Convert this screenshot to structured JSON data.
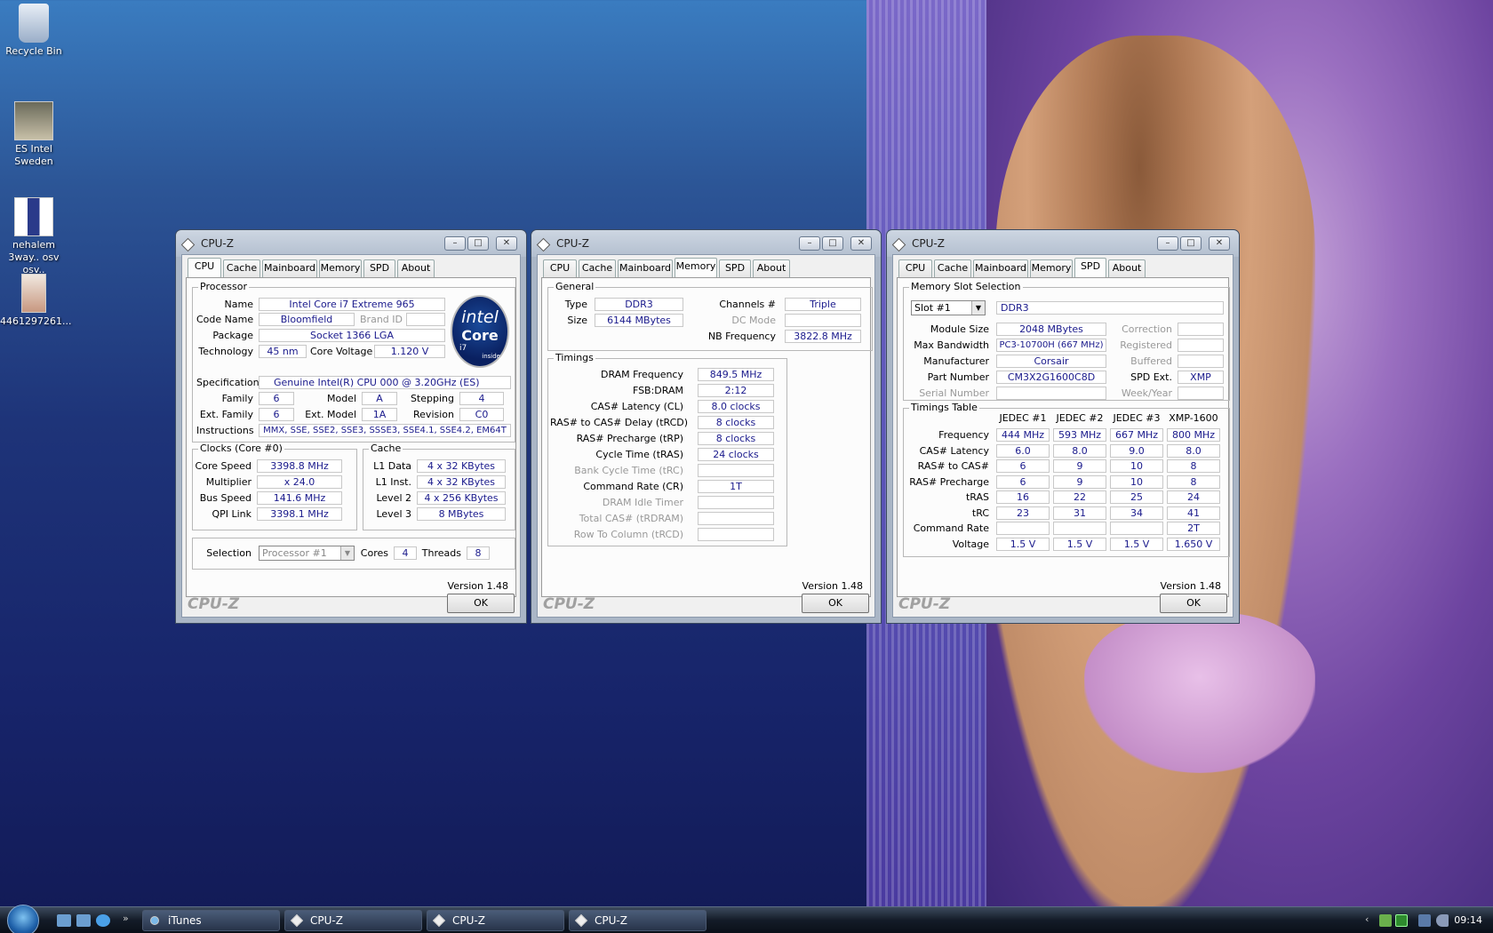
{
  "desktop": {
    "icons": [
      {
        "label": "Recycle Bin"
      },
      {
        "label": "ES Intel Sweden"
      },
      {
        "label": "nehalem 3way.. osv osv.."
      },
      {
        "label": "4461297261..."
      }
    ]
  },
  "tabs": [
    "CPU",
    "Cache",
    "Mainboard",
    "Memory",
    "SPD",
    "About"
  ],
  "window_title": "CPU-Z",
  "version": "Version 1.48",
  "watermark": "CPU-Z",
  "ok_label": "OK",
  "cpu": {
    "group_processor": "Processor",
    "name_lbl": "Name",
    "name": "Intel Core i7 Extreme 965",
    "codename_lbl": "Code Name",
    "codename": "Bloomfield",
    "brandid_lbl": "Brand ID",
    "package_lbl": "Package",
    "package": "Socket 1366 LGA",
    "tech_lbl": "Technology",
    "tech": "45 nm",
    "voltage_lbl": "Core Voltage",
    "voltage": "1.120 V",
    "spec_lbl": "Specification",
    "spec": "Genuine Intel(R) CPU          000  @ 3.20GHz (ES)",
    "family_lbl": "Family",
    "family": "6",
    "model_lbl": "Model",
    "model": "A",
    "stepping_lbl": "Stepping",
    "stepping": "4",
    "extfamily_lbl": "Ext. Family",
    "extfamily": "6",
    "extmodel_lbl": "Ext. Model",
    "extmodel": "1A",
    "revision_lbl": "Revision",
    "revision": "C0",
    "instr_lbl": "Instructions",
    "instr": "MMX, SSE, SSE2, SSE3, SSSE3, SSE4.1, SSE4.2, EM64T",
    "logo_brand": "intel",
    "logo_core": "Core",
    "logo_i7": "i7",
    "logo_inside": "inside",
    "group_clocks": "Clocks (Core #0)",
    "corespeed_lbl": "Core Speed",
    "corespeed": "3398.8 MHz",
    "mult_lbl": "Multiplier",
    "mult": "x 24.0",
    "bus_lbl": "Bus Speed",
    "bus": "141.6 MHz",
    "qpi_lbl": "QPI Link",
    "qpi": "3398.1 MHz",
    "group_cache": "Cache",
    "l1d_lbl": "L1 Data",
    "l1d": "4 x 32 KBytes",
    "l1i_lbl": "L1 Inst.",
    "l1i": "4 x 32 KBytes",
    "l2_lbl": "Level 2",
    "l2": "4 x 256 KBytes",
    "l3_lbl": "Level 3",
    "l3": "8 MBytes",
    "selection_lbl": "Selection",
    "selection": "Processor #1",
    "cores_lbl": "Cores",
    "cores": "4",
    "threads_lbl": "Threads",
    "threads": "8"
  },
  "memory": {
    "group_general": "General",
    "type_lbl": "Type",
    "type": "DDR3",
    "size_lbl": "Size",
    "size": "6144 MBytes",
    "channels_lbl": "Channels #",
    "channels": "Triple",
    "dcmode_lbl": "DC Mode",
    "nbfreq_lbl": "NB Frequency",
    "nbfreq": "3822.8 MHz",
    "group_timings": "Timings",
    "rows": [
      {
        "label": "DRAM Frequency",
        "value": "849.5 MHz",
        "dim": false
      },
      {
        "label": "FSB:DRAM",
        "value": "2:12",
        "dim": false
      },
      {
        "label": "CAS# Latency (CL)",
        "value": "8.0 clocks",
        "dim": false
      },
      {
        "label": "RAS# to CAS# Delay (tRCD)",
        "value": "8 clocks",
        "dim": false
      },
      {
        "label": "RAS# Precharge (tRP)",
        "value": "8 clocks",
        "dim": false
      },
      {
        "label": "Cycle Time (tRAS)",
        "value": "24 clocks",
        "dim": false
      },
      {
        "label": "Bank Cycle Time (tRC)",
        "value": "",
        "dim": true
      },
      {
        "label": "Command Rate (CR)",
        "value": "1T",
        "dim": false
      },
      {
        "label": "DRAM Idle Timer",
        "value": "",
        "dim": true
      },
      {
        "label": "Total CAS# (tRDRAM)",
        "value": "",
        "dim": true
      },
      {
        "label": "Row To Column (tRCD)",
        "value": "",
        "dim": true
      }
    ]
  },
  "spd": {
    "group_slot": "Memory Slot Selection",
    "slot": "Slot #1",
    "slot_type": "DDR3",
    "modsize_lbl": "Module Size",
    "modsize": "2048 MBytes",
    "bandwidth_lbl": "Max Bandwidth",
    "bandwidth": "PC3-10700H (667 MHz)",
    "manuf_lbl": "Manufacturer",
    "manuf": "Corsair",
    "part_lbl": "Part Number",
    "part": "CM3X2G1600C8D",
    "serial_lbl": "Serial Number",
    "correction_lbl": "Correction",
    "registered_lbl": "Registered",
    "buffered_lbl": "Buffered",
    "spdext_lbl": "SPD Ext.",
    "spdext": "XMP",
    "week_lbl": "Week/Year",
    "group_timings": "Timings Table",
    "cols": [
      "JEDEC #1",
      "JEDEC #2",
      "JEDEC #3",
      "XMP-1600"
    ],
    "rows": [
      {
        "label": "Frequency",
        "v": [
          "444 MHz",
          "593 MHz",
          "667 MHz",
          "800 MHz"
        ]
      },
      {
        "label": "CAS# Latency",
        "v": [
          "6.0",
          "8.0",
          "9.0",
          "8.0"
        ]
      },
      {
        "label": "RAS# to CAS#",
        "v": [
          "6",
          "9",
          "10",
          "8"
        ]
      },
      {
        "label": "RAS# Precharge",
        "v": [
          "6",
          "9",
          "10",
          "8"
        ]
      },
      {
        "label": "tRAS",
        "v": [
          "16",
          "22",
          "25",
          "24"
        ]
      },
      {
        "label": "tRC",
        "v": [
          "23",
          "31",
          "34",
          "41"
        ]
      },
      {
        "label": "Command Rate",
        "v": [
          "",
          "",
          "",
          "2T"
        ]
      },
      {
        "label": "Voltage",
        "v": [
          "1.5 V",
          "1.5 V",
          "1.5 V",
          "1.650 V"
        ]
      }
    ]
  },
  "taskbar": {
    "items": [
      "iTunes",
      "CPU-Z",
      "CPU-Z",
      "CPU-Z"
    ],
    "clock": "09:14"
  },
  "colors": {
    "field_text": "#1a1a8c",
    "taskbar": "#141c28"
  }
}
